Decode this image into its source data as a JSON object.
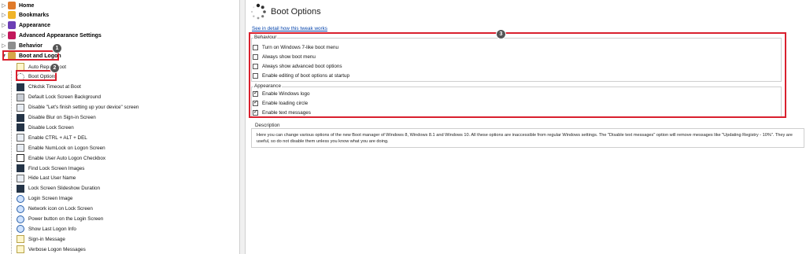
{
  "tree": {
    "top_items": [
      {
        "label": "Home",
        "color": "#e07a2a",
        "expander": "▷"
      },
      {
        "label": "Bookmarks",
        "color": "#f0b429",
        "expander": "▷"
      },
      {
        "label": "Appearance",
        "color": "#6b3fb5",
        "expander": "▷"
      },
      {
        "label": "Advanced Appearance Settings",
        "color": "#c2185b",
        "expander": "▷"
      },
      {
        "label": "Behavior",
        "color": "#8d8d8d",
        "expander": "▷"
      },
      {
        "label": "Boot and Logon",
        "color": "#d7a64a",
        "expander": "▼"
      }
    ],
    "children": [
      {
        "label": "Auto Repair Boot",
        "icon": "note"
      },
      {
        "label": "Boot Options",
        "icon": "spinner"
      },
      {
        "label": "Chkdsk Timeout at Boot",
        "icon": "dark"
      },
      {
        "label": "Default Lock Screen Background",
        "icon": "lock"
      },
      {
        "label": "Disable \"Let's finish setting up your device\" screen",
        "icon": "plain"
      },
      {
        "label": "Disable Blur on Sign-in Screen",
        "icon": "dark"
      },
      {
        "label": "Disable Lock Screen",
        "icon": "dark"
      },
      {
        "label": "Enable CTRL + ALT + DEL",
        "icon": "plain"
      },
      {
        "label": "Enable NumLock on Logon Screen",
        "icon": "plain"
      },
      {
        "label": "Enable User Auto Logon Checkbox",
        "icon": "check"
      },
      {
        "label": "Find Lock Screen Images",
        "icon": "dark"
      },
      {
        "label": "Hide Last User Name",
        "icon": "plain"
      },
      {
        "label": "Lock Screen Slideshow Duration",
        "icon": "dark"
      },
      {
        "label": "Login Screen Image",
        "icon": "globe"
      },
      {
        "label": "Network icon on Lock Screen",
        "icon": "globe"
      },
      {
        "label": "Power button on the Login Screen",
        "icon": "globe"
      },
      {
        "label": "Show Last Logon Info",
        "icon": "globe"
      },
      {
        "label": "Sign-in Message",
        "icon": "note"
      },
      {
        "label": "Verbose Logon Messages",
        "icon": "note"
      }
    ]
  },
  "content": {
    "title": "Boot Options",
    "detail_link": "See in detail how this tweak works",
    "behaviour": {
      "title": "Behaviour",
      "options": [
        {
          "label": "Turn on Windows 7-like boot menu",
          "checked": false
        },
        {
          "label": "Always show boot menu",
          "checked": false
        },
        {
          "label": "Always show advanced boot options",
          "checked": false
        },
        {
          "label": "Enable editing of boot options at startup",
          "checked": false
        }
      ]
    },
    "appearance": {
      "title": "Appearance",
      "options": [
        {
          "label": "Enable Windows logo",
          "checked": true
        },
        {
          "label": "Enable loading circle",
          "checked": true
        },
        {
          "label": "Enable text messages",
          "checked": true
        }
      ]
    },
    "description": {
      "title": "Description",
      "text": "Here you can change various options of the new Boot manager of Windows 8, Windows 8.1 and Windows 10. All these options are inaccessible from regular Windows settings. The \"Disable text messages\" option will remove messages like \"Updating Registry - 10%\". They are useful, so do not disable them unless you know what you are doing."
    }
  },
  "annotations": {
    "badge1": "1",
    "badge2": "2",
    "badge3": "3",
    "color": "#d9202e"
  }
}
